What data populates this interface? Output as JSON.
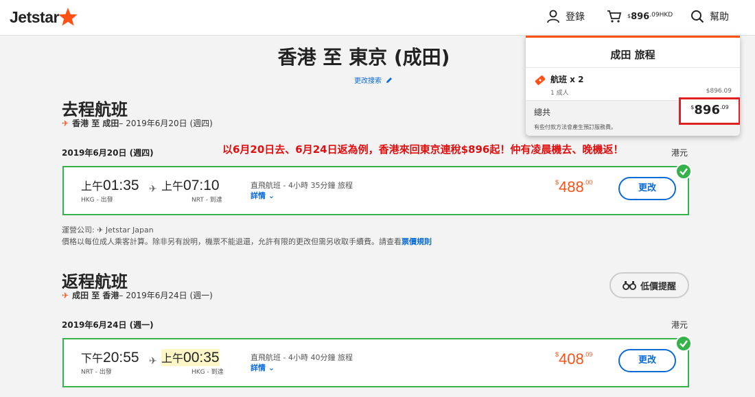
{
  "header": {
    "logo": "Jetstar",
    "login": "登錄",
    "cart_currency_symbol": "$",
    "cart_amount": "896",
    "cart_cents": ".09",
    "cart_currency": "HKD",
    "help": "幫助"
  },
  "cart": {
    "title": "成田 旅程",
    "flights_label": "航班 x 2",
    "passengers": "1 成人",
    "subtotal": "$896.09",
    "total_label": "總共",
    "total_symbol": "$",
    "total_amount": "896",
    "total_cents": ".09",
    "fee_note": "有些付款方法會產生預訂服務費。"
  },
  "page": {
    "title": "香港 至 東京 (成田)",
    "change_search": "更改搜索",
    "promo": "以6月20日去、6月24日返為例，香港來回東京連稅$896起！仲有凌晨機去、晚機返！"
  },
  "outbound": {
    "section_title": "去程航班",
    "route": "香港 至 成田",
    "route_date": " – 2019年6月20日 (週四)",
    "date_row": "2019年6月20日 (週四)",
    "currency": "港元",
    "dep_ampm": "上午",
    "dep_time": "01:35",
    "dep_place": "HKG - 出發",
    "arr_ampm": "上午",
    "arr_time": "07:10",
    "arr_place": "NRT - 到達",
    "description": "直飛航班 - 4小時 35分鐘 旅程",
    "details": "詳情 ⌄",
    "fare_symbol": "$",
    "fare": "488",
    "fare_cents": ".00",
    "change": "更改"
  },
  "info": {
    "operator": "運營公司: ✈ Jetstar Japan",
    "price_note": "價格以每位成人乘客計算。除非另有說明，機票不能退還，允許有限的更改但需另收取手續費。請查看",
    "fare_rules": "票價規則"
  },
  "return": {
    "section_title": "返程航班",
    "route": "成田 至 香港",
    "route_date": " – 2019年6月24日 (週一)",
    "price_alert": "低價提醒",
    "date_row": "2019年6月24日 (週一)",
    "currency": "港元",
    "dep_ampm": "下午",
    "dep_time": "20:55",
    "dep_place": "NRT - 出發",
    "arr_ampm": "上午",
    "arr_time": "00:35",
    "arr_place": "HKG - 到達",
    "description": "直飛航班 - 4小時 40分鐘 旅程",
    "details": "詳情 ⌄",
    "fare_symbol": "$",
    "fare": "408",
    "fare_cents": ".09",
    "change": "更改"
  },
  "colors": {
    "brand_orange": "#ff5115",
    "link_blue": "#0a6ad6",
    "selected_green": "#35b34a",
    "promo_red": "#e01010"
  }
}
